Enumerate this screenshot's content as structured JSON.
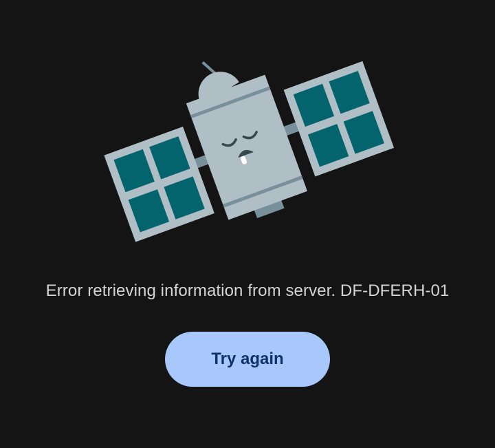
{
  "error": {
    "message": "Error retrieving information from server. DF-DFERH-01",
    "illustration_icon": "sleeping-satellite-icon"
  },
  "actions": {
    "retry_label": "Try again"
  },
  "colors": {
    "background": "#141414",
    "message_text": "#d4d4d4",
    "button_background": "#a8c8fb",
    "button_text": "#0e3368",
    "satellite_body": "#b0bec5",
    "solar_panel": "#04646e",
    "satellite_stripe": "#78909c"
  }
}
